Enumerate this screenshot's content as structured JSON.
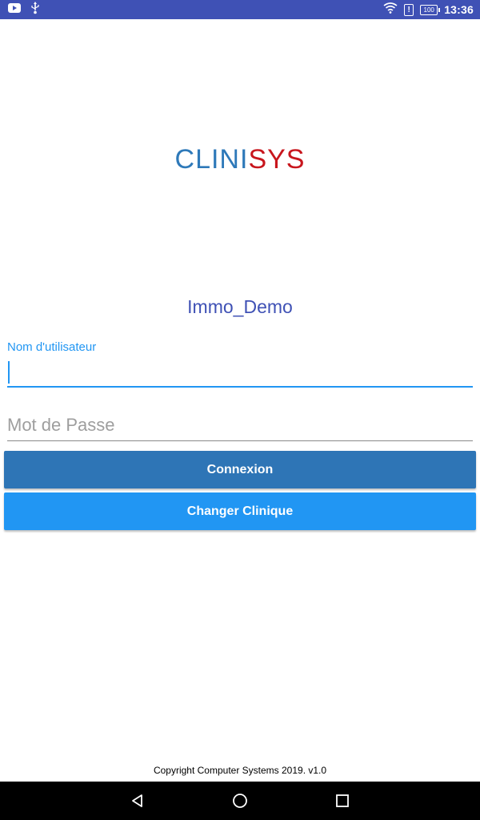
{
  "status_bar": {
    "time": "13:36",
    "battery_level": "100",
    "icons": [
      "youtube-icon",
      "usb-icon",
      "wifi-icon",
      "alert-icon",
      "battery-icon"
    ]
  },
  "logo": {
    "part1": "CLINI",
    "part2": "SYS",
    "color1": "#2e79b9",
    "color2": "#c8161d"
  },
  "clinic": {
    "name": "Immo_Demo"
  },
  "form": {
    "username_label": "Nom d'utilisateur",
    "username_value": "",
    "password_placeholder": "Mot de Passe",
    "password_value": ""
  },
  "buttons": {
    "connexion": "Connexion",
    "change_clinic": "Changer Clinique"
  },
  "footer": {
    "copyright": "Copyright Computer Systems 2019. v1.0"
  },
  "nav_bar": {
    "icons": [
      "back-icon",
      "home-icon",
      "recents-icon"
    ]
  },
  "colors": {
    "status_bar": "#3f51b5",
    "accent": "#2196f3",
    "primary_button": "#2e75b6"
  }
}
